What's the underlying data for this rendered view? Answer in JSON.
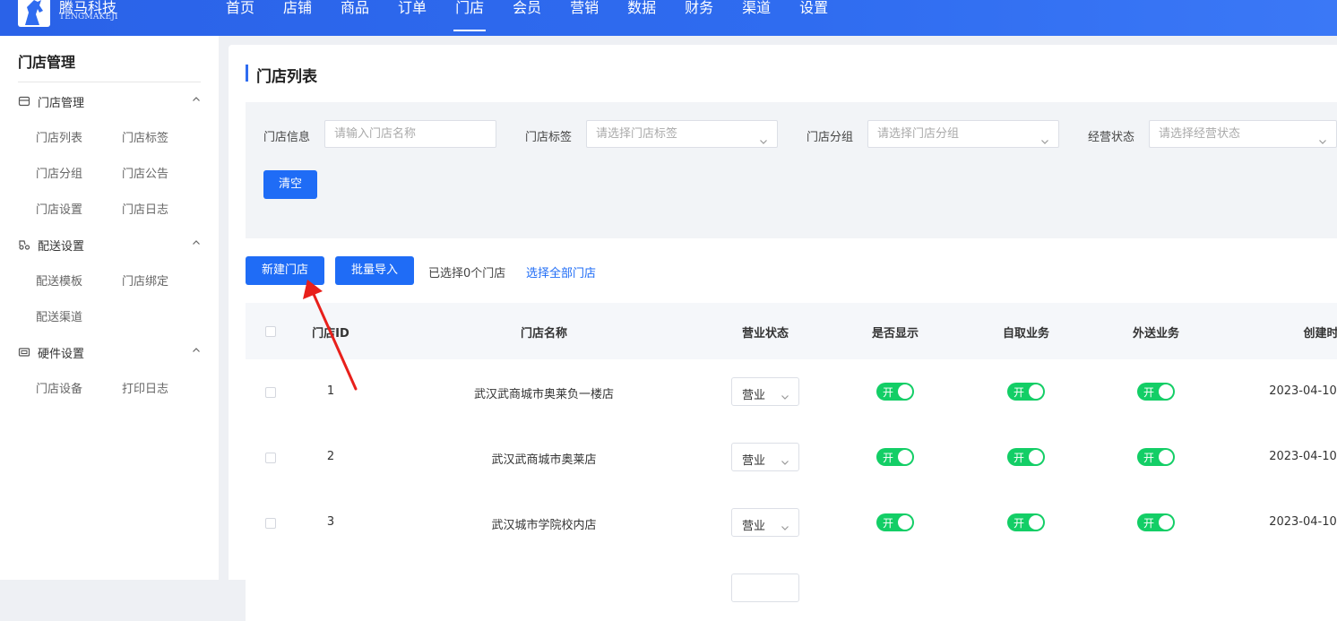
{
  "brand": {
    "name_cn": "腾马科技",
    "name_en": "TENGMAKEJI"
  },
  "nav": {
    "items": [
      {
        "label": "首页",
        "active": false
      },
      {
        "label": "店铺",
        "active": false
      },
      {
        "label": "商品",
        "active": false
      },
      {
        "label": "订单",
        "active": false
      },
      {
        "label": "门店",
        "active": true
      },
      {
        "label": "会员",
        "active": false
      },
      {
        "label": "营销",
        "active": false
      },
      {
        "label": "数据",
        "active": false
      },
      {
        "label": "财务",
        "active": false
      },
      {
        "label": "渠道",
        "active": false
      },
      {
        "label": "设置",
        "active": false
      }
    ]
  },
  "sidebar": {
    "title": "门店管理",
    "groups": [
      {
        "label": "门店管理",
        "icon": "store-icon",
        "links": [
          "门店列表",
          "门店标签",
          "门店分组",
          "门店公告",
          "门店设置",
          "门店日志"
        ]
      },
      {
        "label": "配送设置",
        "icon": "delivery-icon",
        "links": [
          "配送模板",
          "门店绑定",
          "配送渠道"
        ]
      },
      {
        "label": "硬件设置",
        "icon": "hardware-icon",
        "links": [
          "门店设备",
          "打印日志"
        ]
      }
    ]
  },
  "page": {
    "title": "门店列表"
  },
  "filters": {
    "store_info": {
      "label": "门店信息",
      "placeholder": "请输入门店名称"
    },
    "store_tag": {
      "label": "门店标签",
      "placeholder": "请选择门店标签"
    },
    "store_group": {
      "label": "门店分组",
      "placeholder": "请选择门店分组"
    },
    "business_status": {
      "label": "经营状态",
      "placeholder": "请选择经营状态"
    },
    "clear_label": "清空"
  },
  "actions": {
    "new_store": "新建门店",
    "batch_import": "批量导入",
    "selected_text": "已选择0个门店",
    "select_all": "选择全部门店"
  },
  "table": {
    "headers": {
      "id": "门店ID",
      "name": "门店名称",
      "status": "营业状态",
      "display": "是否显示",
      "pickup": "自取业务",
      "delivery": "外送业务",
      "created": "创建时"
    },
    "toggle_on_label": "开",
    "rows": [
      {
        "id": "1",
        "name": "武汉武商城市奥莱负一楼店",
        "status": "营业",
        "created": "2023-04-10"
      },
      {
        "id": "2",
        "name": "武汉武商城市奥莱店",
        "status": "营业",
        "created": "2023-04-10"
      },
      {
        "id": "3",
        "name": "武汉城市学院校内店",
        "status": "营业",
        "created": "2023-04-10"
      }
    ]
  },
  "colors": {
    "nav_bg": "#2f6cf0",
    "primary": "#1f6cf6",
    "toggle_on": "#13ce66",
    "annotation": "#e8201b"
  }
}
